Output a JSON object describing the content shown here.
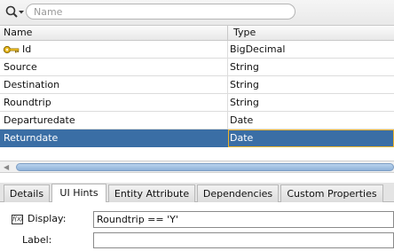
{
  "search": {
    "placeholder": "Name",
    "dropdown_icon": "magnifier-dropdown-icon"
  },
  "table": {
    "columns": [
      "Name",
      "Type"
    ],
    "rows": [
      {
        "name": "Id",
        "type": "BigDecimal",
        "key": true
      },
      {
        "name": "Source",
        "type": "String"
      },
      {
        "name": "Destination",
        "type": "String"
      },
      {
        "name": "Roundtrip",
        "type": "String"
      },
      {
        "name": "Departuredate",
        "type": "Date"
      },
      {
        "name": "Returndate",
        "type": "Date",
        "selected": true
      }
    ],
    "selection_color": "#3a6ea5",
    "key_icon": "key-icon"
  },
  "tabs": [
    {
      "label": "Details"
    },
    {
      "label": "UI Hints",
      "active": true
    },
    {
      "label": "Entity Attribute"
    },
    {
      "label": "Dependencies"
    },
    {
      "label": "Custom Properties"
    }
  ],
  "form": {
    "display_label": "Display:",
    "display_value": "Roundtrip == 'Y'",
    "display_icon_text": "f(x)",
    "label_label": "Label:",
    "label_value": ""
  }
}
